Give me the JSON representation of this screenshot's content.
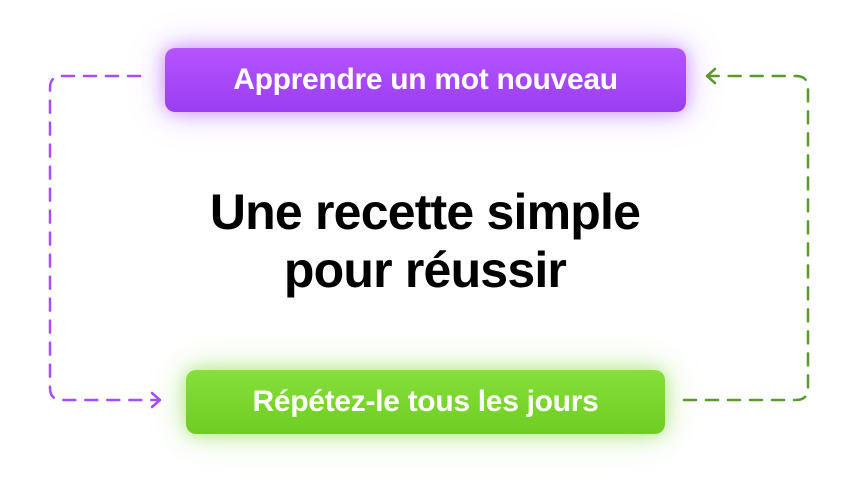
{
  "top_step": {
    "label": "Apprendre un mot nouveau",
    "color": "#a549fb"
  },
  "headline": {
    "line1": "Une recette simple",
    "line2": "pour réussir"
  },
  "bottom_step": {
    "label": "Répétez-le tous les jours",
    "color": "#79d52e"
  },
  "connectors": {
    "left_color": "#a64dff",
    "right_color": "#5a9a2a",
    "style": "dashed"
  }
}
